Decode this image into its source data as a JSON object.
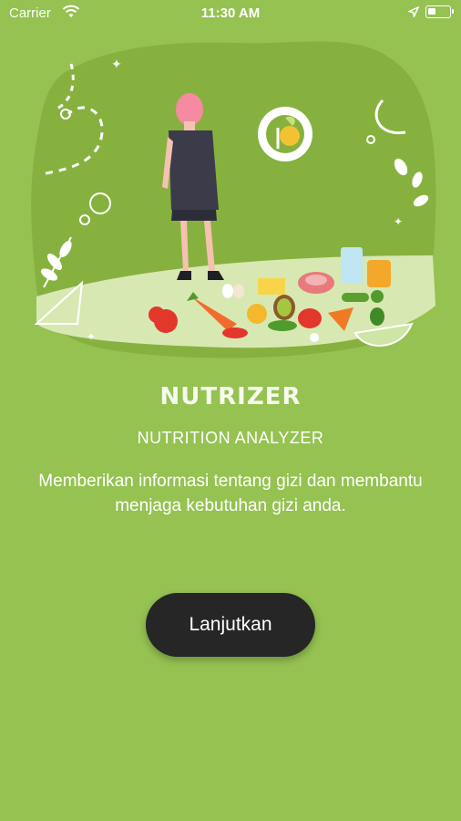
{
  "status_bar": {
    "carrier": "Carrier",
    "time": "11:30 AM"
  },
  "hero": {
    "illustration": "woman-with-groceries-illustration"
  },
  "app": {
    "name": "NUTRIZER",
    "tagline": "NUTRITION ANALYZER",
    "description": "Memberikan informasi tentang gizi dan membantu menjaga kebutuhan gizi anda."
  },
  "actions": {
    "continue_label": "Lanjutkan"
  },
  "colors": {
    "background": "#95c251",
    "hero_blob": "#86b13f",
    "button": "#262626"
  }
}
